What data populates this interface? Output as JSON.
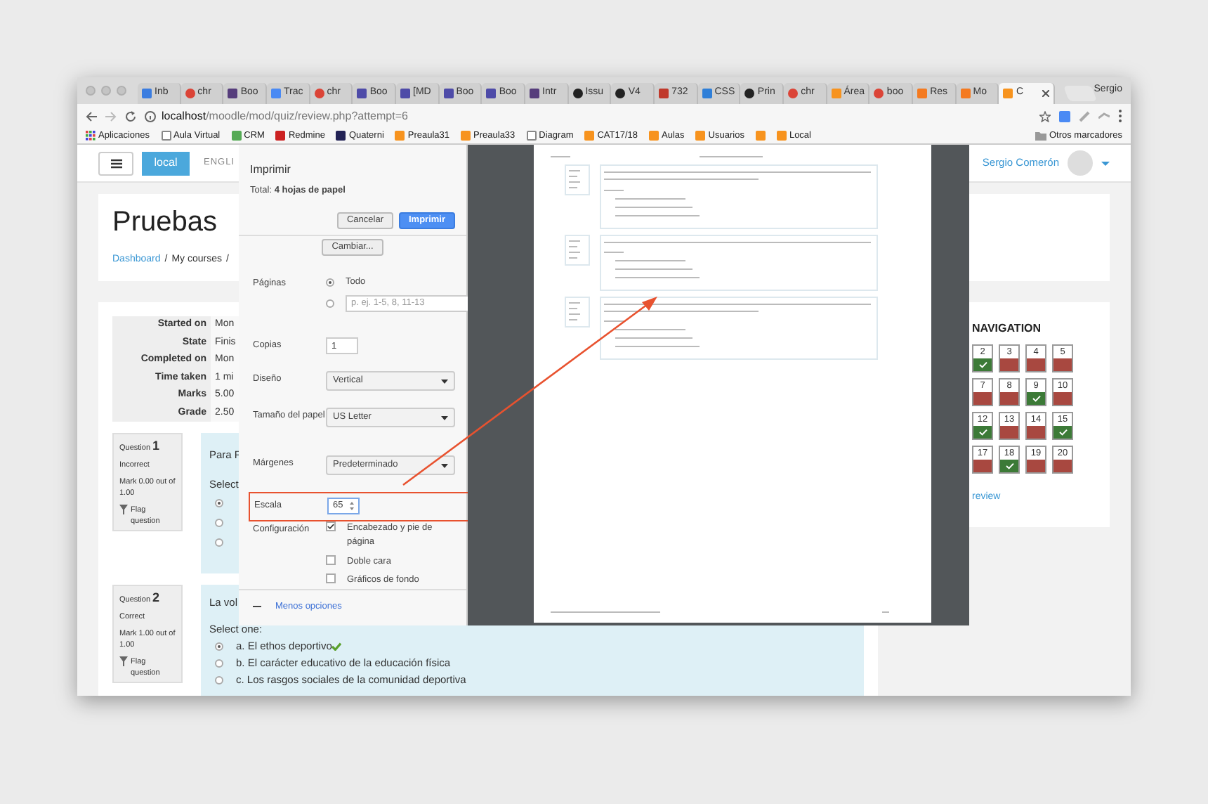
{
  "browser": {
    "tabs": [
      {
        "title": "Inb",
        "kind": "mail",
        "selected": false
      },
      {
        "title": "chr",
        "kind": "google",
        "selected": false
      },
      {
        "title": "Boo",
        "kind": "bootstrap",
        "selected": false
      },
      {
        "title": "Trac",
        "kind": "translate",
        "selected": false
      },
      {
        "title": "chr",
        "kind": "google",
        "selected": false
      },
      {
        "title": "Boo",
        "kind": "purple",
        "selected": false
      },
      {
        "title": "[MD",
        "kind": "purple",
        "selected": false
      },
      {
        "title": "Boo",
        "kind": "purple",
        "selected": false
      },
      {
        "title": "Boo",
        "kind": "purple",
        "selected": false
      },
      {
        "title": "Intr",
        "kind": "bootstrap",
        "selected": false
      },
      {
        "title": "Issu",
        "kind": "github",
        "selected": false
      },
      {
        "title": "V4",
        "kind": "github",
        "selected": false
      },
      {
        "title": "732",
        "kind": "calendar",
        "selected": false
      },
      {
        "title": "CSS",
        "kind": "search",
        "selected": false
      },
      {
        "title": "Prin",
        "kind": "github",
        "selected": false
      },
      {
        "title": "chr",
        "kind": "google",
        "selected": false
      },
      {
        "title": "Área",
        "kind": "orange",
        "selected": false
      },
      {
        "title": "boo",
        "kind": "google",
        "selected": false
      },
      {
        "title": "Res",
        "kind": "orange-solid",
        "selected": false
      },
      {
        "title": "Mo",
        "kind": "orange-solid",
        "selected": false
      },
      {
        "title": "C",
        "kind": "orange",
        "selected": true
      }
    ],
    "profile": "Sergio",
    "url": {
      "host": "localhost",
      "path": "/moodle/mod/quiz/review.php?attempt=6"
    },
    "bookmarks": [
      {
        "label": "Aplicaciones",
        "kind": "apps"
      },
      {
        "label": "Aula Virtual",
        "kind": "page"
      },
      {
        "label": "CRM",
        "kind": "people"
      },
      {
        "label": "Redmine",
        "kind": "arc"
      },
      {
        "label": "Quaterni",
        "kind": "cross"
      },
      {
        "label": "Preaula31",
        "kind": "orange"
      },
      {
        "label": "Preaula33",
        "kind": "orange"
      },
      {
        "label": "Diagram",
        "kind": "page"
      },
      {
        "label": "CAT17/18",
        "kind": "orange"
      },
      {
        "label": "Aulas",
        "kind": "orange"
      },
      {
        "label": "Usuarios",
        "kind": "orange"
      },
      {
        "kind": "orange"
      },
      {
        "label": "Local",
        "kind": "orange"
      }
    ],
    "other_bookmarks": "Otros marcadores"
  },
  "navbar": {
    "brand": "local",
    "language": "ENGLI",
    "user": "Sergio Comerón"
  },
  "header": {
    "title": "Pruebas",
    "breadcrumb": [
      {
        "label": "Dashboard",
        "link": true,
        "separator": "/"
      },
      {
        "label": "My courses",
        "link": false,
        "separator": "/"
      }
    ]
  },
  "summary": [
    {
      "label": "Started on",
      "value": "Mon"
    },
    {
      "label": "State",
      "value": "Finis"
    },
    {
      "label": "Completed on",
      "value": "Mon"
    },
    {
      "label": "Time taken",
      "value": "1 mi"
    },
    {
      "label": "Marks",
      "value": "5.00"
    },
    {
      "label": "Grade",
      "value": "2.50"
    }
  ],
  "questions": [
    {
      "label": "Question",
      "number": "1",
      "status": "Incorrect",
      "mark": "Mark 0.00 out of 1.00",
      "flag": "Flag question",
      "text": "Para F",
      "prompt": "Select",
      "options": [
        {
          "selected": true
        },
        {
          "selected": false
        },
        {
          "selected": false
        }
      ]
    },
    {
      "label": "Question",
      "number": "2",
      "status": "Correct",
      "mark": "Mark 1.00 out of 1.00",
      "flag": "Flag question",
      "text": "La vol",
      "prompt": "Select one:",
      "options": [
        {
          "label": "a. El ethos deportivo",
          "selected": true,
          "correct": true
        },
        {
          "label": "b. El carácter educativo de la educación física",
          "selected": false
        },
        {
          "label": "c. Los rasgos sociales de la comunidad deportiva",
          "selected": false
        }
      ]
    }
  ],
  "quiz_navigation": {
    "title": "NAVIGATION",
    "buttons": [
      {
        "number": "2",
        "correct": true
      },
      {
        "number": "3",
        "correct": false
      },
      {
        "number": "4",
        "correct": false
      },
      {
        "number": "5",
        "correct": false
      },
      {
        "number": "7",
        "correct": false
      },
      {
        "number": "8",
        "correct": false
      },
      {
        "number": "9",
        "correct": true
      },
      {
        "number": "10",
        "correct": false
      },
      {
        "number": "12",
        "correct": true
      },
      {
        "number": "13",
        "correct": false
      },
      {
        "number": "14",
        "correct": false
      },
      {
        "number": "15",
        "correct": true
      },
      {
        "number": "17",
        "correct": false
      },
      {
        "number": "18",
        "correct": true
      },
      {
        "number": "19",
        "correct": false
      },
      {
        "number": "20",
        "correct": false
      }
    ],
    "link": "review"
  },
  "print_dialog": {
    "title": "Imprimir",
    "total": "Total: **4 hojas de papel**",
    "buttons": [
      {
        "label": "Cancelar",
        "kind": "secondary"
      },
      {
        "label": "Imprimir",
        "kind": "primary"
      }
    ],
    "change": "Cambiar...",
    "settings": [
      {
        "kind": "radios",
        "label": "Páginas",
        "options": [
          {
            "label": "Todo",
            "selected": true
          },
          {
            "placeholder": "p. ej. 1-5, 8, 11-13",
            "selected": false
          }
        ]
      },
      {
        "kind": "number",
        "label": "Copias",
        "value": "1"
      },
      {
        "kind": "select",
        "label": "Diseño",
        "value": "Vertical"
      },
      {
        "kind": "select",
        "label": "Tamaño del papel",
        "value": "US Letter"
      },
      {
        "kind": "select",
        "label": "Márgenes",
        "value": "Predeterminado"
      },
      {
        "kind": "spinner",
        "label": "Escala",
        "value": "65",
        "highlighted": true
      },
      {
        "kind": "checkboxes",
        "label": "Configuración",
        "options": [
          {
            "label": "Encabezado y pie de página",
            "checked": true
          },
          {
            "label": "Doble cara",
            "checked": false
          },
          {
            "label": "Gráficos de fondo",
            "checked": false
          }
        ]
      }
    ],
    "less_options": "Menos opciones"
  }
}
